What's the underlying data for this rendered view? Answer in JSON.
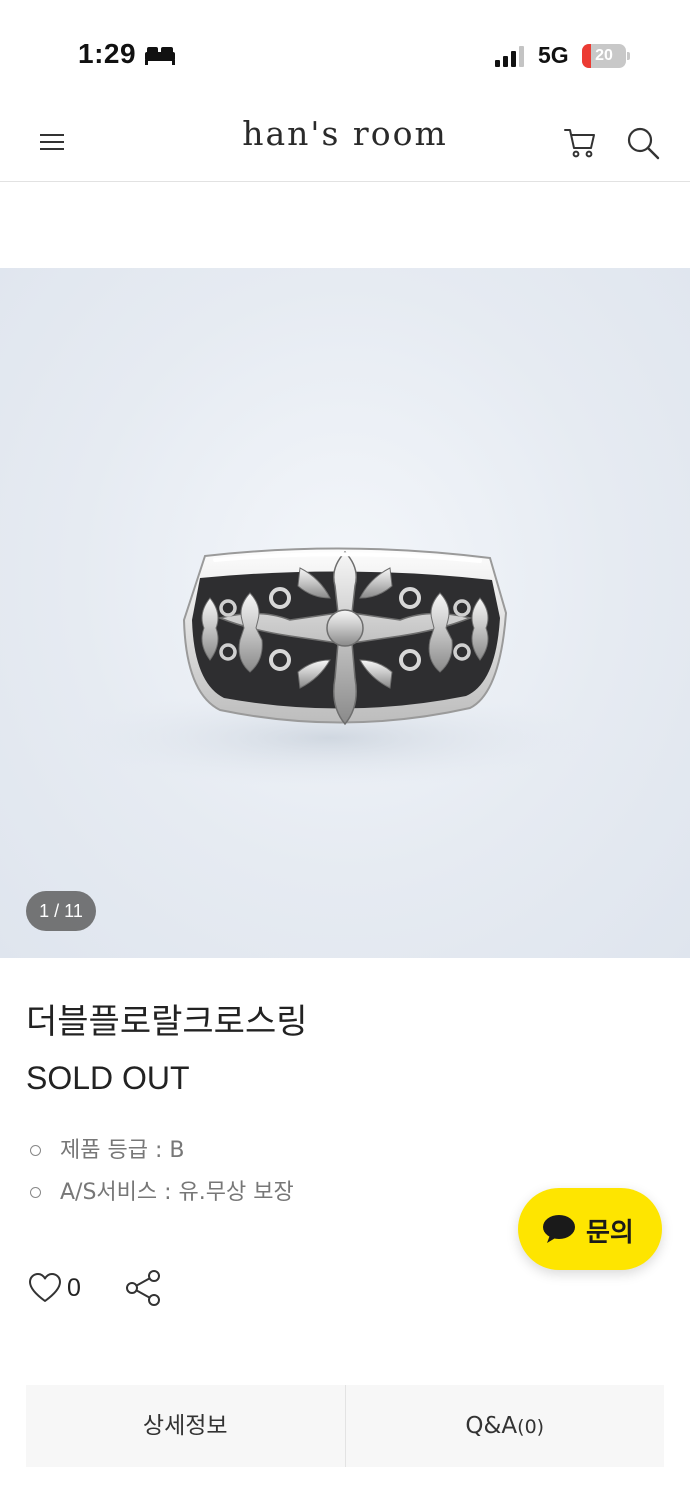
{
  "status_bar": {
    "time": "1:29",
    "network": "5G",
    "battery_percent": 20,
    "battery_label": "20",
    "battery_color": "#ec3b33"
  },
  "header": {
    "brand": "han's room",
    "icons": [
      "menu-icon",
      "cart-icon",
      "search-icon"
    ]
  },
  "gallery": {
    "counter": "1 / 11",
    "current_index": 1,
    "total": 11
  },
  "product": {
    "title": "더블플로랄크로스링",
    "status": "SOLD OUT",
    "specs": [
      {
        "label": "제품 등급 : B"
      },
      {
        "label": "A/S서비스 :  유.무상 보장"
      }
    ],
    "like_count": "0"
  },
  "chat": {
    "label": "문의",
    "color": "#fee500"
  },
  "tabs": {
    "detail": "상세정보",
    "qa_label": "Q&A",
    "qa_count": "(0)"
  }
}
